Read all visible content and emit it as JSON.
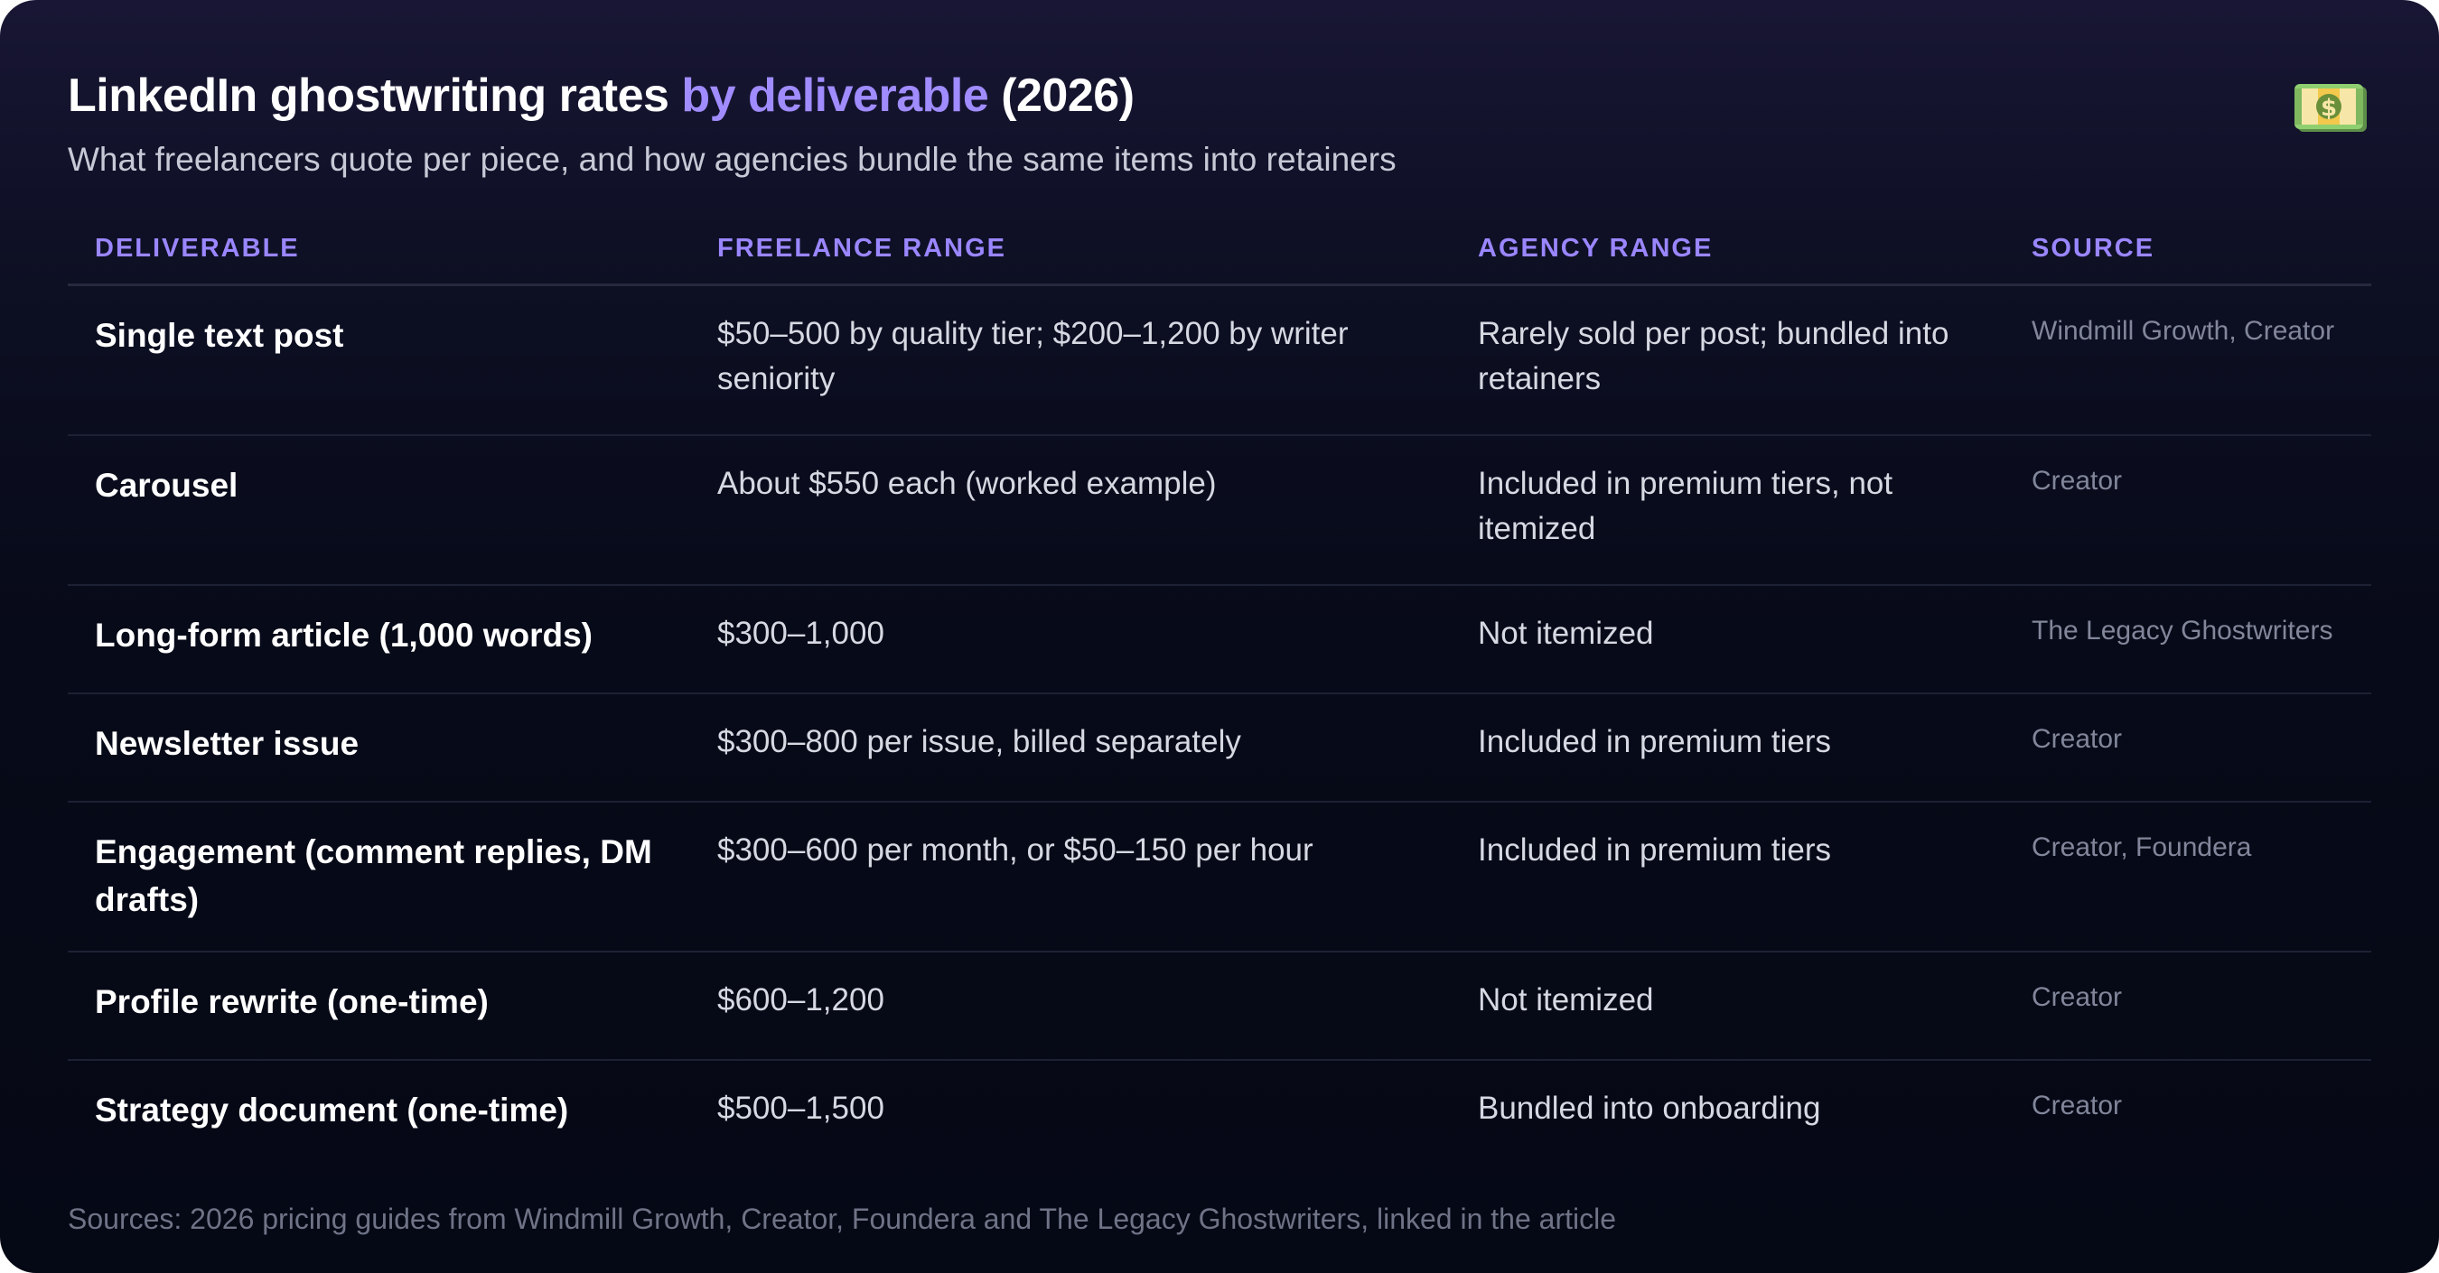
{
  "header": {
    "title_part1": "LinkedIn ghostwriting rates ",
    "title_accent": "by deliverable",
    "title_part2": " (2026)",
    "subtitle": "What freelancers quote per piece, and how agencies bundle the same items into retainers",
    "icon": "money-bag-icon"
  },
  "colors": {
    "accent": "#a08cff",
    "background": "#070a18"
  },
  "table": {
    "columns": [
      "DELIVERABLE",
      "FREELANCE RANGE",
      "AGENCY RANGE",
      "SOURCE"
    ],
    "rows": [
      {
        "deliverable": "Single text post",
        "freelance": "$50–500 by quality tier; $200–1,200 by writer seniority",
        "agency": "Rarely sold per post; bundled into retainers",
        "source": "Windmill Growth, Creator"
      },
      {
        "deliverable": "Carousel",
        "freelance": "About $550 each (worked example)",
        "agency": "Included in premium tiers, not itemized",
        "source": "Creator"
      },
      {
        "deliverable": "Long-form article (1,000 words)",
        "freelance": "$300–1,000",
        "agency": "Not itemized",
        "source": "The Legacy Ghostwriters"
      },
      {
        "deliverable": "Newsletter issue",
        "freelance": "$300–800 per issue, billed separately",
        "agency": "Included in premium tiers",
        "source": "Creator"
      },
      {
        "deliverable": "Engagement (comment replies, DM drafts)",
        "freelance": "$300–600 per month, or $50–150 per hour",
        "agency": "Included in premium tiers",
        "source": "Creator, Foundera"
      },
      {
        "deliverable": "Profile rewrite (one-time)",
        "freelance": "$600–1,200",
        "agency": "Not itemized",
        "source": "Creator"
      },
      {
        "deliverable": "Strategy document (one-time)",
        "freelance": "$500–1,500",
        "agency": "Bundled into onboarding",
        "source": "Creator"
      }
    ]
  },
  "footnote": "Sources: 2026 pricing guides from Windmill Growth, Creator, Foundera and The Legacy Ghostwriters, linked in the article"
}
